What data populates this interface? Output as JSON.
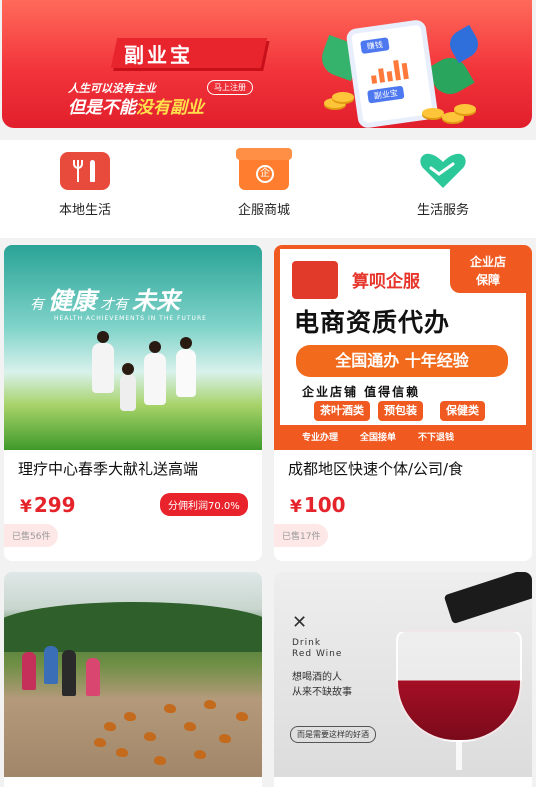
{
  "banner": {
    "brand": "副业宝",
    "line1": "人生可以没有主业",
    "signup": "马上注册",
    "line2_a": "但是不能",
    "line2_b": "没有副业",
    "phone_tag": "赚钱",
    "phone_sub": "副业宝",
    "colors": {
      "primary": "#f2343b",
      "highlight": "#ffe14b"
    }
  },
  "categories": [
    {
      "label": "本地生活",
      "icon": "fork-knife-icon",
      "color": "#e84b3c"
    },
    {
      "label": "企服商城",
      "icon": "store-icon",
      "color": "#ff7d2f"
    },
    {
      "label": "生活服务",
      "icon": "handshake-heart-icon",
      "color": "#2cc89a"
    }
  ],
  "products": [
    {
      "title": "理疗中心春季大献礼送高端",
      "price_symbol": "¥",
      "price": "299",
      "commission": "分佣利润70.0%",
      "sold": "已售56件",
      "image": {
        "headline_a": "有",
        "headline_b": "健康",
        "headline_c": "才有",
        "headline_d": "未来",
        "subline": "HEALTH ACHIEVEMENTS IN THE FUTURE"
      }
    },
    {
      "title": "成都地区快速个体/公司/食",
      "price_symbol": "¥",
      "price": "100",
      "sold": "已售17件",
      "image": {
        "corner_tag_1": "企业店",
        "corner_tag_2": "保障",
        "brand": "算呗企服",
        "headline": "电商资质代办",
        "banner": "全国通办  十年经验",
        "trust": "企业店铺 值得信赖",
        "chips": [
          "茶叶酒类",
          "预包装",
          "保健类"
        ],
        "bottom": [
          "专业办理",
          "全国接单",
          "不下退钱"
        ]
      }
    },
    {
      "title": "",
      "image": {}
    },
    {
      "title": "",
      "image": {
        "en": "Drink\nRed Wine",
        "cn_1": "想喝酒的人",
        "cn_2": "从来不缺故事",
        "tagline": "而是需要这样的好酒"
      }
    }
  ]
}
